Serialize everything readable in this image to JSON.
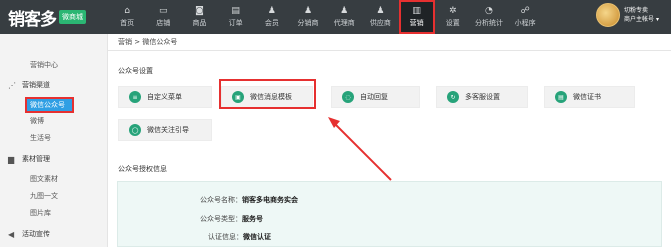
{
  "logo": {
    "text": "销客多",
    "badge": "微商城"
  },
  "nav": [
    {
      "label": "首页",
      "icon": "home-icon",
      "glyph": "⌂"
    },
    {
      "label": "店铺",
      "icon": "store-icon",
      "glyph": "▭"
    },
    {
      "label": "商品",
      "icon": "goods-icon",
      "glyph": "◙"
    },
    {
      "label": "订单",
      "icon": "order-icon",
      "glyph": "▤"
    },
    {
      "label": "会员",
      "icon": "member-icon",
      "glyph": "♟"
    },
    {
      "label": "分销商",
      "icon": "distributor-icon",
      "glyph": "♟"
    },
    {
      "label": "代理商",
      "icon": "agent-icon",
      "glyph": "♟"
    },
    {
      "label": "供应商",
      "icon": "supplier-icon",
      "glyph": "♟"
    },
    {
      "label": "营销",
      "icon": "marketing-icon",
      "glyph": "▥",
      "active": true
    },
    {
      "label": "设置",
      "icon": "settings-icon",
      "glyph": "✲"
    },
    {
      "label": "分析统计",
      "icon": "analytics-icon",
      "glyph": "◔"
    },
    {
      "label": "小程序",
      "icon": "miniprogram-icon",
      "glyph": "☍"
    }
  ],
  "user": {
    "line1": "切粉专卖",
    "line2": "商户主帐号"
  },
  "sidebar": {
    "marketing_center": "营销中心",
    "marketing_channel": "营销渠道",
    "wechat_official": "微信公众号",
    "weibo": "微博",
    "life_account": "生活号",
    "material_manage": "素材管理",
    "image_text": "图文素材",
    "nine_grid": "九图一文",
    "image_library": "图片库",
    "promotion": "活动宣传"
  },
  "breadcrumb": {
    "root": "营销",
    "sep": ">",
    "current": "微信公众号"
  },
  "official_settings": {
    "title": "公众号设置",
    "cards": [
      {
        "label": "自定义菜单",
        "icon": "menu-icon",
        "glyph": "≡"
      },
      {
        "label": "微信消息模板",
        "icon": "template-icon",
        "glyph": "▣"
      },
      {
        "label": "自动回复",
        "icon": "reply-icon",
        "glyph": "◌"
      },
      {
        "label": "多客服设置",
        "icon": "service-icon",
        "glyph": "↻"
      },
      {
        "label": "微信证书",
        "icon": "certificate-icon",
        "glyph": "▤"
      },
      {
        "label": "微信关注引导",
        "icon": "follow-guide-icon",
        "glyph": "◯"
      }
    ]
  },
  "auth_info": {
    "title": "公众号授权信息",
    "name_label": "公众号名称：",
    "name_value": "销客多电商务实会",
    "type_label": "公众号类型：",
    "type_value": "服务号",
    "cert_label": "认证信息：",
    "cert_value": "微信认证"
  },
  "colors": {
    "topbar": "#373d41",
    "accent_red": "#e63030",
    "active_blue": "#2f9fe4",
    "green": "#27a37a"
  }
}
